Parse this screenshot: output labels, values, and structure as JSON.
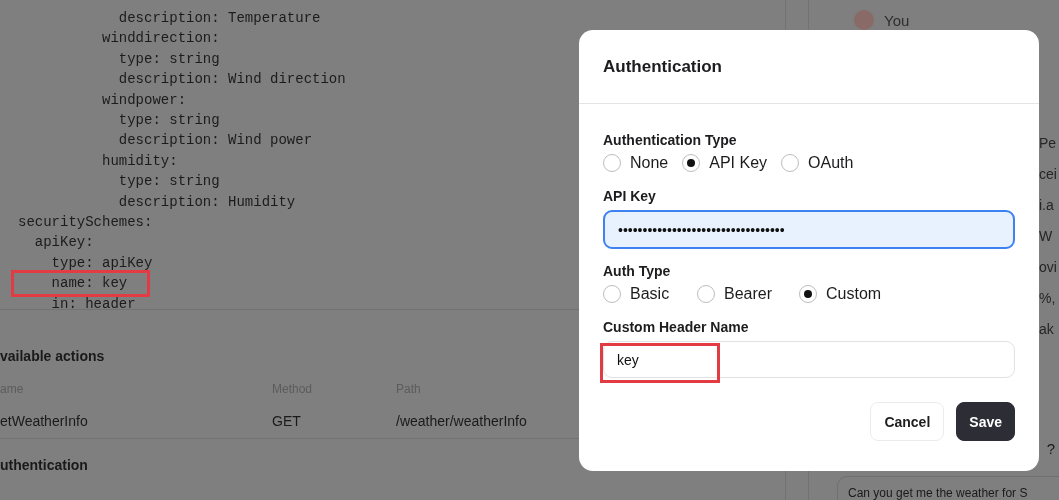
{
  "code_lines": [
    {
      "text": "            description: Temperature",
      "highlighted": false
    },
    {
      "text": "          winddirection:",
      "highlighted": false
    },
    {
      "text": "            type: string",
      "highlighted": false
    },
    {
      "text": "            description: Wind direction",
      "highlighted": false
    },
    {
      "text": "          windpower:",
      "highlighted": false
    },
    {
      "text": "            type: string",
      "highlighted": false
    },
    {
      "text": "            description: Wind power",
      "highlighted": false
    },
    {
      "text": "          humidity:",
      "highlighted": false
    },
    {
      "text": "            type: string",
      "highlighted": false
    },
    {
      "text": "            description: Humidity",
      "highlighted": false
    },
    {
      "text": "securitySchemes:",
      "highlighted": false
    },
    {
      "text": "  apiKey:",
      "highlighted": false
    },
    {
      "text": "    type: apiKey",
      "highlighted": false
    },
    {
      "text": "    name: key",
      "highlighted": true
    },
    {
      "text": "    in: header",
      "highlighted": false
    }
  ],
  "actions": {
    "title": "vailable actions",
    "columns": [
      "ame",
      "Method",
      "Path"
    ],
    "rows": [
      [
        "etWeatherInfo",
        "GET",
        "/weather/weatherInfo"
      ]
    ]
  },
  "auth_section": {
    "title": "uthentication"
  },
  "chat": {
    "author": "You",
    "fragments": [
      "Pe",
      "cei",
      "i.a",
      "W",
      "ovi",
      "%,",
      "ak"
    ],
    "end_mark": "?",
    "input_text": "Can you get me the weather for S"
  },
  "dialog": {
    "title": "Authentication",
    "auth_type": {
      "label": "Authentication Type",
      "options": [
        {
          "label": "None",
          "selected": false
        },
        {
          "label": "API Key",
          "selected": true
        },
        {
          "label": "OAuth",
          "selected": false
        }
      ]
    },
    "api_key": {
      "label": "API Key",
      "value": "••••••••••••••••••••••••••••••••••",
      "focused": true
    },
    "header_type": {
      "label": "Auth Type",
      "options": [
        {
          "label": "Basic",
          "selected": false
        },
        {
          "label": "Bearer",
          "selected": false
        },
        {
          "label": "Custom",
          "selected": true
        }
      ]
    },
    "custom_header": {
      "label": "Custom Header Name",
      "value": "key",
      "highlighted": true
    },
    "buttons": [
      {
        "label": "Cancel",
        "kind": "secondary"
      },
      {
        "label": "Save",
        "kind": "primary"
      }
    ]
  }
}
